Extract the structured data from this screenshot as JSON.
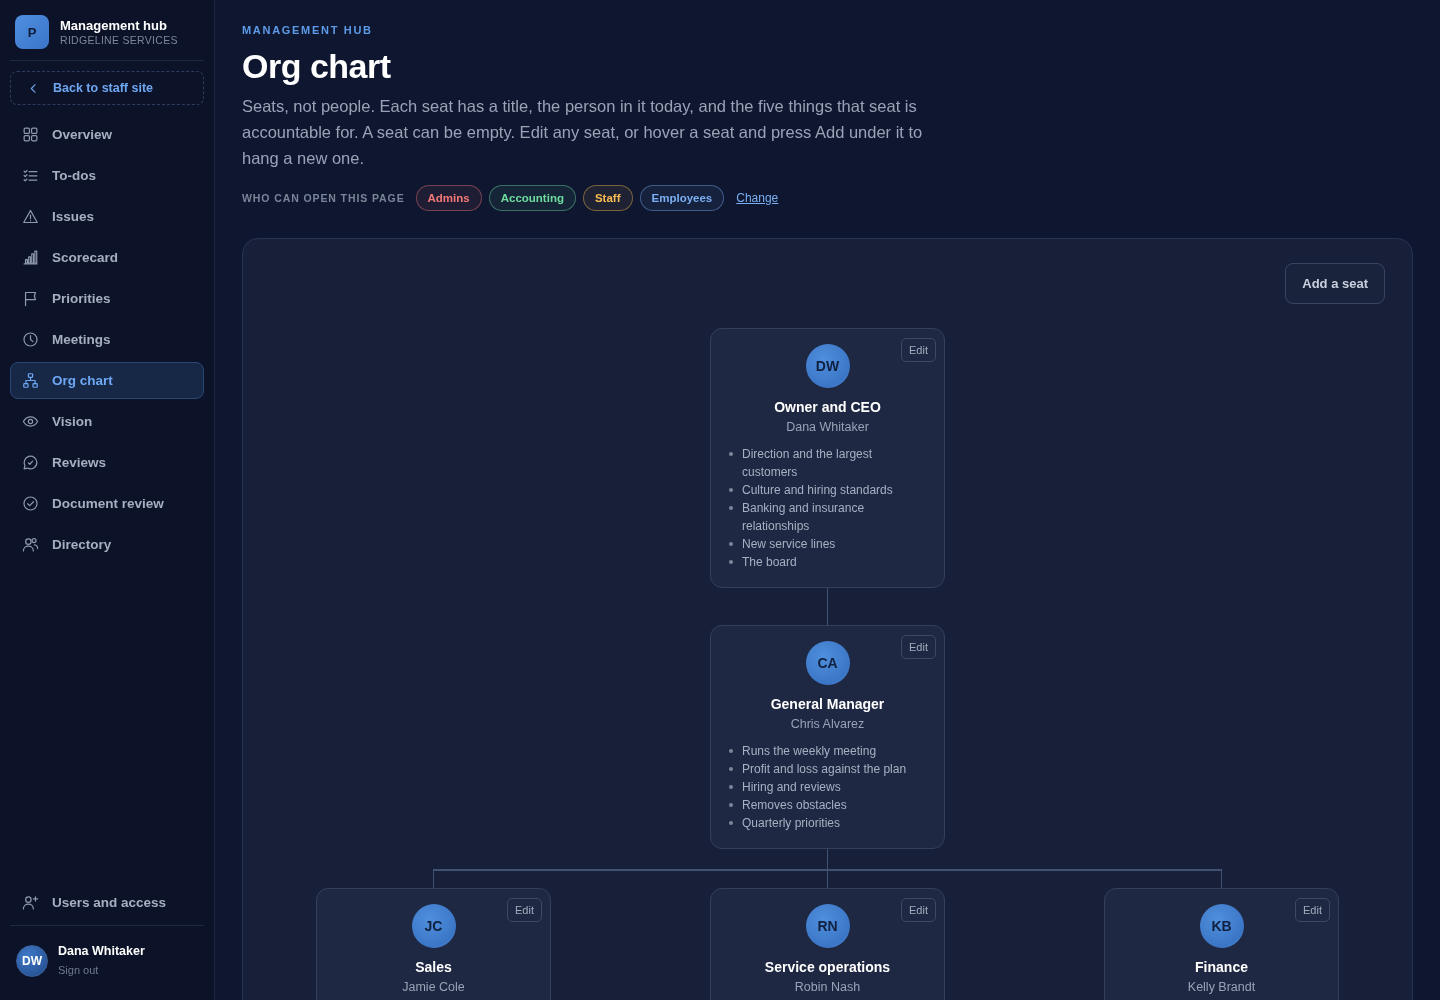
{
  "sidebar": {
    "brand": {
      "logo": "P",
      "title": "Management hub",
      "subtitle": "RIDGELINE SERVICES"
    },
    "back_link": "Back to staff site",
    "items": [
      {
        "label": "Overview",
        "selected": false
      },
      {
        "label": "To-dos",
        "selected": false
      },
      {
        "label": "Issues",
        "selected": false
      },
      {
        "label": "Scorecard",
        "selected": false
      },
      {
        "label": "Priorities",
        "selected": false
      },
      {
        "label": "Meetings",
        "selected": false
      },
      {
        "label": "Org chart",
        "selected": true
      },
      {
        "label": "Vision",
        "selected": false
      },
      {
        "label": "Reviews",
        "selected": false
      },
      {
        "label": "Document review",
        "selected": false
      },
      {
        "label": "Directory",
        "selected": false
      }
    ],
    "footer_item": "Users and access",
    "user": {
      "initials": "DW",
      "name": "Dana Whitaker",
      "action": "Sign out"
    }
  },
  "header": {
    "eyebrow": "MANAGEMENT HUB",
    "title": "Org chart",
    "description": "Seats, not people. Each seat has a title, the person in it today, and the five things that seat is accountable for. A seat can be empty. Edit any seat, or hover a seat and press Add under it to hang a new one.",
    "access": {
      "label": "WHO CAN OPEN THIS PAGE",
      "groups": [
        {
          "label": "Admins",
          "color": "#f47878"
        },
        {
          "label": "Accounting",
          "color": "#6fdc9f"
        },
        {
          "label": "Staff",
          "color": "#f9bd52"
        },
        {
          "label": "Employees",
          "color": "#7aaef2"
        }
      ],
      "change_link": "Change"
    }
  },
  "chart_panel": {
    "add_button": "Add a seat",
    "root": {
      "initials": "DW",
      "title": "Owner and CEO",
      "person": "Dana Whitaker",
      "edit_label": "Edit",
      "accountabilities": [
        "Direction and the largest customers",
        "Culture and hiring standards",
        "Banking and insurance relationships",
        "New service lines",
        "The board"
      ],
      "children": [
        {
          "initials": "CA",
          "title": "General Manager",
          "person": "Chris Alvarez",
          "edit_label": "Edit",
          "accountabilities": [
            "Runs the weekly meeting",
            "Profit and loss against the plan",
            "Hiring and reviews",
            "Removes obstacles",
            "Quarterly priorities"
          ],
          "children": [
            {
              "initials": "JC",
              "title": "Sales",
              "person": "Jamie Cole",
              "edit_label": "Edit"
            },
            {
              "initials": "RN",
              "title": "Service operations",
              "person": "Robin Nash",
              "edit_label": "Edit"
            },
            {
              "initials": "KB",
              "title": "Finance",
              "person": "Kelly Brandt",
              "edit_label": "Edit"
            }
          ]
        }
      ]
    }
  }
}
